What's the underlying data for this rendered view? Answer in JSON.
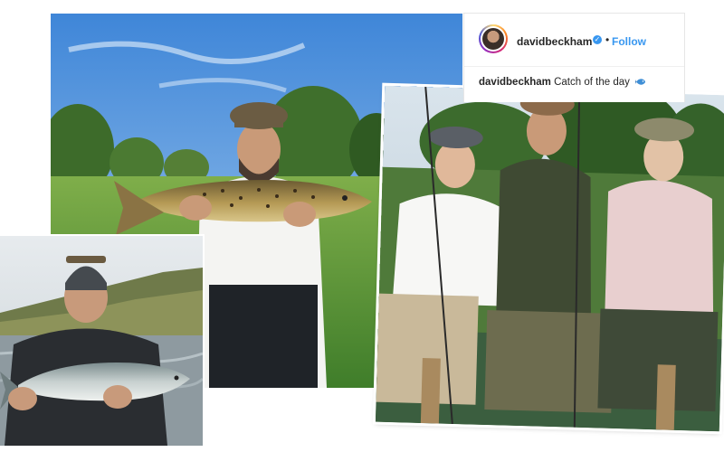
{
  "post": {
    "username": "davidbeckham",
    "verified_icon": "verified-badge-icon",
    "separator": "•",
    "follow_label": "Follow",
    "caption_user": "davidbeckham",
    "caption_text": "Catch of the day",
    "caption_emoji": "fish-emoji-icon"
  },
  "colors": {
    "link_blue": "#3897f0",
    "text_dark": "#262626"
  }
}
